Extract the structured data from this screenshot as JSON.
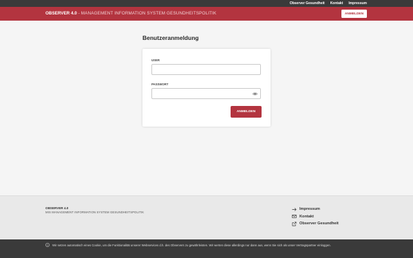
{
  "top_links": [
    "Observer Gesundheit",
    "Kontakt",
    "Impressum"
  ],
  "header": {
    "brand_name": "OBSERVER 4.0",
    "brand_subtitle": " - MANAGEMENT INFORMATION SYSTEM GESUNDHEITSPOLITIK",
    "login_label": "ANMELDEN"
  },
  "login": {
    "title": "Benutzeranmeldung",
    "user_label": "USER",
    "user_value": "",
    "password_label": "PASSWORT",
    "password_value": "",
    "submit_label": "ANMELDEN"
  },
  "footer": {
    "title": "OBSERVER 4.0",
    "subtitle": "MIS MANAGEMENT INFORMATION SYSTEM GESUNDHEITSPOLITIK",
    "links": [
      {
        "label": "Impressum",
        "icon": "arrow-right-icon"
      },
      {
        "label": "Kontakt",
        "icon": "mail-icon"
      },
      {
        "label": "Observer Gesundheit",
        "icon": "external-link-icon"
      }
    ]
  },
  "cookie_notice": {
    "text": "Wir setzen automatisch eines Cookie, um die Funktionalität unserer Webservices d.h. des Observers zu gewährleisten. Wir werten diese allerdings nur dann aus, wenn Sie sich als unser Vertragspartner einloggen.",
    "icon": "info-icon"
  },
  "colors": {
    "brand_red": "#b3343f",
    "dark_bar": "#3a3a3a"
  }
}
